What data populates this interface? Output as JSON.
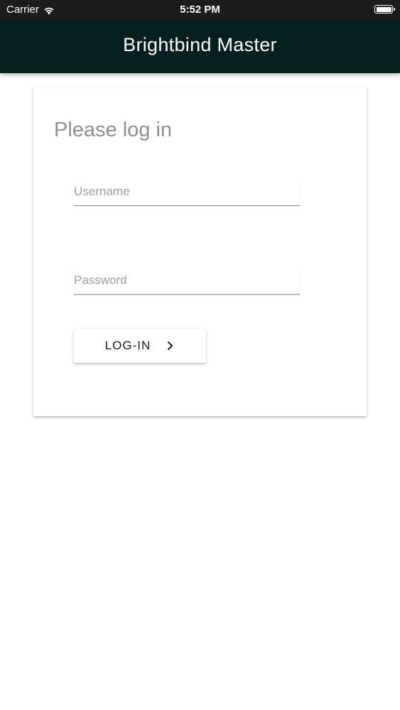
{
  "status_bar": {
    "carrier": "Carrier",
    "time": "5:52 PM"
  },
  "app_bar": {
    "title": "Brightbind Master"
  },
  "login_card": {
    "heading": "Please log in",
    "username_placeholder": "Username",
    "password_placeholder": "Password",
    "username_value": "",
    "password_value": "",
    "login_button_label": "LOG-IN",
    "login_button_icon": "chevron-right-icon"
  },
  "colors": {
    "status_bar_bg": "#1c1c1c",
    "app_bar_bg": "#05201f",
    "heading_text": "#8e8e94",
    "placeholder_text": "#9e9e9e"
  }
}
